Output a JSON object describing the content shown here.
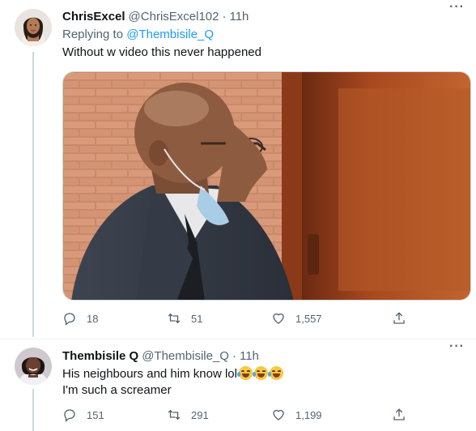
{
  "tweets": [
    {
      "name": "ChrisExcel",
      "handle": "@ChrisExcel102",
      "separator": "·",
      "time": "11h",
      "replying_prefix": "Replying to",
      "replying_to": "@Thembisile_Q",
      "text_lines": [
        "Without w video this never happened"
      ],
      "has_media": true,
      "stats": {
        "replies": "18",
        "retweets": "51",
        "likes": "1,557"
      },
      "icons": [
        "reply-icon",
        "retweet-icon",
        "heart-icon",
        "share-icon"
      ]
    },
    {
      "name": "Thembisile Q",
      "handle": "@Thembisile_Q",
      "separator": "·",
      "time": "11h",
      "text_lines": [
        "His neighbours and him know lol",
        "I'm such a screamer"
      ],
      "emoji": "face-with-tears-of-joy",
      "emoji_count": 3,
      "stats": {
        "replies": "151",
        "retweets": "291",
        "likes": "1,199"
      },
      "icons": [
        "reply-icon",
        "retweet-icon",
        "heart-icon",
        "share-icon"
      ]
    }
  ],
  "more_label": "···",
  "colors": {
    "link": "#1d9bf0",
    "secondary": "#536471",
    "text": "#0f1419",
    "thread_line": "#cfd9de"
  }
}
